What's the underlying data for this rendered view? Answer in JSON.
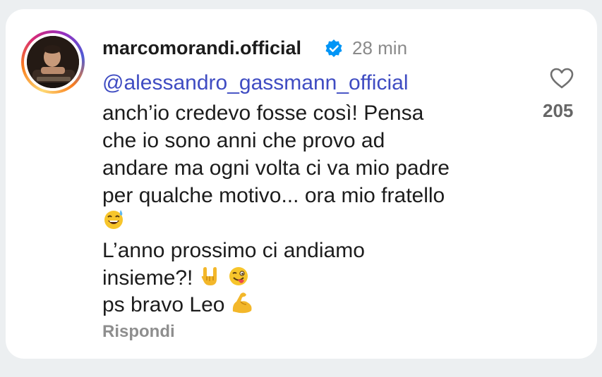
{
  "comment": {
    "username": "marcomorandi.official",
    "verified_icon": "verified-badge-icon",
    "time": "28 min",
    "mention": "@alessandro_gassmann_official",
    "lines": [
      "anch’io credevo fosse così! Pensa",
      "che io sono anni che provo ad",
      "andare ma ogni volta ci va mio padre",
      "per qualche motivo... ora mio fratello",
      "",
      "L’anno prossimo ci andiamo",
      "insieme?!",
      "ps bravo Leo"
    ],
    "emojis": {
      "sweat_smile": "sweat-smile-emoji",
      "rock_on": "rock-on-hand-emoji",
      "wink_tongue": "winking-tongue-emoji",
      "flexed_bicep": "flexed-bicep-emoji"
    },
    "reply_label": "Rispondi",
    "likes_count": "205",
    "like_icon": "heart-icon"
  },
  "colors": {
    "mention": "#3f4cc2",
    "verified": "#0095f6",
    "text": "#1c1c1c",
    "muted": "#8e8e8e"
  }
}
